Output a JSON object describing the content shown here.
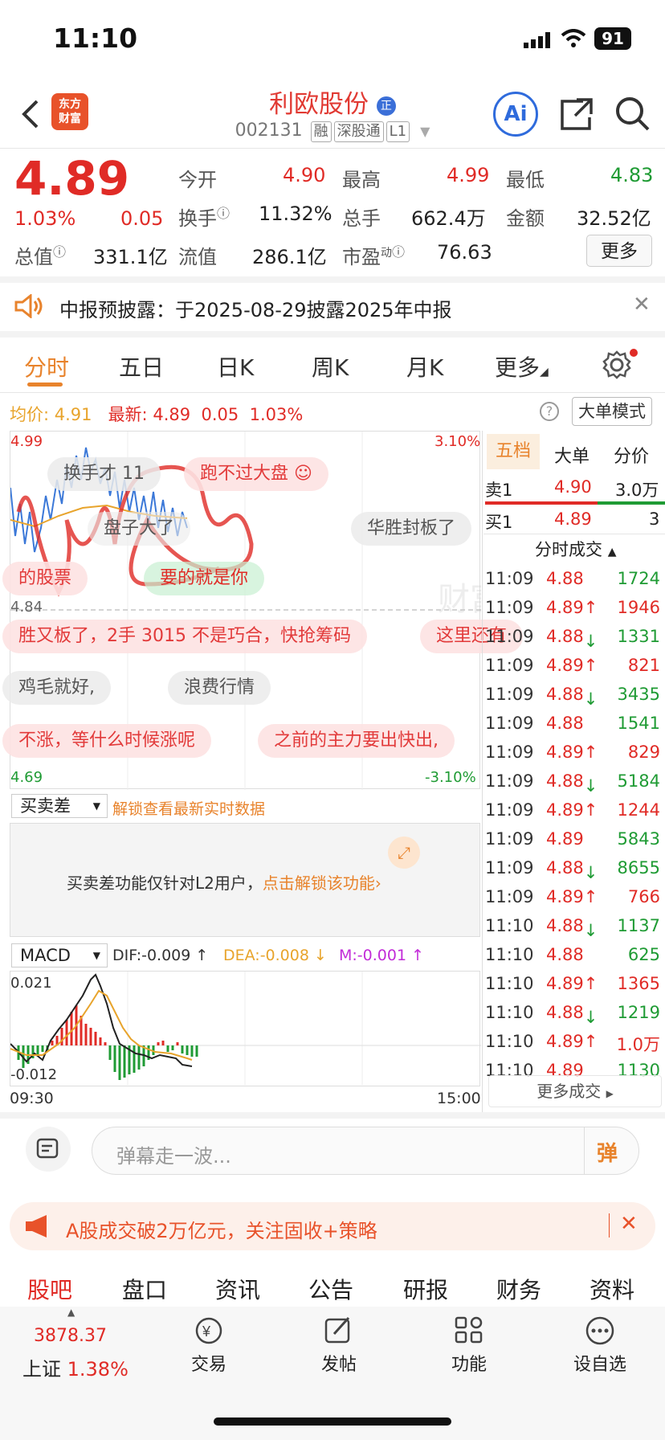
{
  "status": {
    "time": "11:10",
    "battery": "91"
  },
  "header": {
    "logo": "东方\n财富",
    "stock_name": "利欧股份",
    "badge": "正",
    "code": "002131",
    "tags": [
      "融",
      "深股通",
      "L1"
    ],
    "ai": "Ai"
  },
  "quote": {
    "price": "4.89",
    "pct": "1.03%",
    "chg": "0.05",
    "today_open_label": "今开",
    "today_open": "4.90",
    "high_label": "最高",
    "high": "4.99",
    "low_label": "最低",
    "low": "4.83",
    "turnover_label": "换手",
    "turnover": "11.32%",
    "volume_label": "总手",
    "volume": "662.4万",
    "amount_label": "金额",
    "amount": "32.52亿",
    "mktcap_label": "总值",
    "mktcap": "331.1亿",
    "float_label": "流值",
    "float": "286.1亿",
    "pe_label": "市盈",
    "pe_sup": "动",
    "pe": "76.63",
    "more": "更多"
  },
  "notice": {
    "text": "中报预披露：于2025-08-29披露2025年中报"
  },
  "tabs": [
    "分时",
    "五日",
    "日K",
    "周K",
    "月K",
    "更多"
  ],
  "chart_info": {
    "avg_label": "均价:",
    "avg": "4.91",
    "latest_label": "最新:",
    "latest": "4.89",
    "chg": "0.05",
    "pct": "1.03%",
    "mode": "大单模式",
    "ymax": "4.99",
    "ymin": "4.69",
    "ymid": "4.84",
    "pmax": "3.10%",
    "pmin": "-3.10%",
    "watermark": "财富"
  },
  "danmaku": [
    "换手才 11",
    "跑不过大盘",
    "盘子大了",
    "华胜封板了",
    "的股票",
    "要的就是你",
    "胜又板了，2手 3015 不是巧合，快抢筹码",
    "这里还有",
    "鸡毛就好,",
    "浪费行情",
    "不涨，等什么时候涨呢",
    "之前的主力要出快出,"
  ],
  "ind1": {
    "select": "买卖差",
    "unlock": "解锁查看最新实时数据",
    "msg": "买卖差功能仅针对L2用户，",
    "link": "点击解锁该功能"
  },
  "macd": {
    "select": "MACD",
    "dif": "DIF:-0.009 ↑",
    "dea": "DEA:-0.008 ↓",
    "m": "M:-0.001 ↑",
    "top": "0.021",
    "bottom": "-0.012",
    "t_start": "09:30",
    "t_end": "15:00"
  },
  "right": {
    "tabs": [
      "五档",
      "大单",
      "分价"
    ],
    "sell1": [
      "卖1",
      "4.90",
      "3.0万"
    ],
    "buy1": [
      "买1",
      "4.89",
      "3"
    ],
    "ticks_title": "分时成交",
    "ticks": [
      [
        "11:09",
        "4.88",
        "1724",
        "n"
      ],
      [
        "11:09",
        "4.89↑",
        "1946",
        "r"
      ],
      [
        "11:09",
        "4.88↓",
        "1331",
        "g"
      ],
      [
        "11:09",
        "4.89↑",
        "821",
        "r"
      ],
      [
        "11:09",
        "4.88↓",
        "3435",
        "g"
      ],
      [
        "11:09",
        "4.88",
        "1541",
        "n"
      ],
      [
        "11:09",
        "4.89↑",
        "829",
        "r"
      ],
      [
        "11:09",
        "4.88↓",
        "5184",
        "g"
      ],
      [
        "11:09",
        "4.89↑",
        "1244",
        "r"
      ],
      [
        "11:09",
        "4.89",
        "5843",
        "n"
      ],
      [
        "11:09",
        "4.88↓",
        "8655",
        "g"
      ],
      [
        "11:09",
        "4.89↑",
        "766",
        "r"
      ],
      [
        "11:10",
        "4.88↓",
        "1137",
        "g"
      ],
      [
        "11:10",
        "4.88",
        "625",
        "n"
      ],
      [
        "11:10",
        "4.89↑",
        "1365",
        "r"
      ],
      [
        "11:10",
        "4.88↓",
        "1219",
        "g"
      ],
      [
        "11:10",
        "4.89↑",
        "1.0万",
        "r"
      ],
      [
        "11:10",
        "4.89",
        "1130",
        "n"
      ]
    ],
    "more": "更多成交"
  },
  "comment": {
    "placeholder": "弹幕走一波...",
    "btn": "弹"
  },
  "promo": {
    "text": "A股成交破2万亿元，关注固收+策略"
  },
  "subtabs": [
    "股吧",
    "盘口",
    "资讯",
    "公告",
    "研报",
    "财务",
    "资料"
  ],
  "bottom": {
    "index": "3878.37",
    "index_name": "上证",
    "index_pct": "1.38%",
    "items": [
      "交易",
      "发帖",
      "功能",
      "设自选"
    ]
  }
}
